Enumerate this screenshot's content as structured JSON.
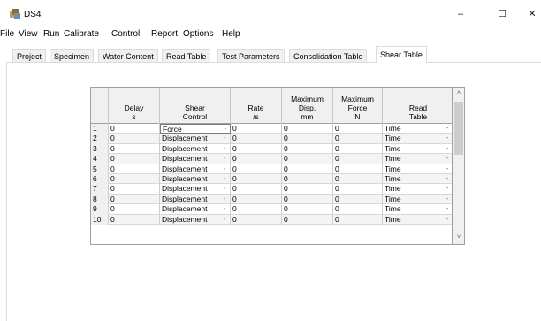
{
  "window": {
    "title": "DS4",
    "minimize_glyph": "–",
    "maximize_glyph": "☐",
    "close_glyph": "✕"
  },
  "menu": [
    "File",
    "View",
    "Run",
    "Calibrate",
    "Control",
    "Report",
    "Options",
    "Help"
  ],
  "tabs": [
    "Project",
    "Specimen",
    "Water Content",
    "Read Table",
    "Test Parameters",
    "Consolidation Table",
    "Shear Table"
  ],
  "active_tab": "Shear Table",
  "table": {
    "headers": [
      {
        "l1": "",
        "l2": "",
        "l3": ""
      },
      {
        "l1": "",
        "l2": "Delay",
        "l3": "s"
      },
      {
        "l1": "Shear",
        "l2": "Control",
        "l3": ""
      },
      {
        "l1": "",
        "l2": "Rate",
        "l3": "/s"
      },
      {
        "l1": "Maximum",
        "l2": "Disp.",
        "l3": "mm"
      },
      {
        "l1": "Maximum",
        "l2": "Force",
        "l3": "N"
      },
      {
        "l1": "Read",
        "l2": "Table",
        "l3": ""
      }
    ],
    "rows": [
      {
        "n": "1",
        "delay": "0",
        "control": "Force",
        "rate": "0",
        "disp": "0",
        "force": "0",
        "read": "Time"
      },
      {
        "n": "2",
        "delay": "0",
        "control": "Displacement",
        "rate": "0",
        "disp": "0",
        "force": "0",
        "read": "Time"
      },
      {
        "n": "3",
        "delay": "0",
        "control": "Displacement",
        "rate": "0",
        "disp": "0",
        "force": "0",
        "read": "Time"
      },
      {
        "n": "4",
        "delay": "0",
        "control": "Displacement",
        "rate": "0",
        "disp": "0",
        "force": "0",
        "read": "Time"
      },
      {
        "n": "5",
        "delay": "0",
        "control": "Displacement",
        "rate": "0",
        "disp": "0",
        "force": "0",
        "read": "Time"
      },
      {
        "n": "6",
        "delay": "0",
        "control": "Displacement",
        "rate": "0",
        "disp": "0",
        "force": "0",
        "read": "Time"
      },
      {
        "n": "7",
        "delay": "0",
        "control": "Displacement",
        "rate": "0",
        "disp": "0",
        "force": "0",
        "read": "Time"
      },
      {
        "n": "8",
        "delay": "0",
        "control": "Displacement",
        "rate": "0",
        "disp": "0",
        "force": "0",
        "read": "Time"
      },
      {
        "n": "9",
        "delay": "0",
        "control": "Displacement",
        "rate": "0",
        "disp": "0",
        "force": "0",
        "read": "Time"
      },
      {
        "n": "10",
        "delay": "0",
        "control": "Displacement",
        "rate": "0",
        "disp": "0",
        "force": "0",
        "read": "Time"
      }
    ],
    "dropdown_glyph": "-",
    "scroll_up_glyph": "˄",
    "scroll_down_glyph": "˅"
  },
  "icons": {
    "app": "app-icon",
    "minimize": "minimize-icon",
    "maximize": "maximize-icon",
    "close": "close-icon"
  }
}
